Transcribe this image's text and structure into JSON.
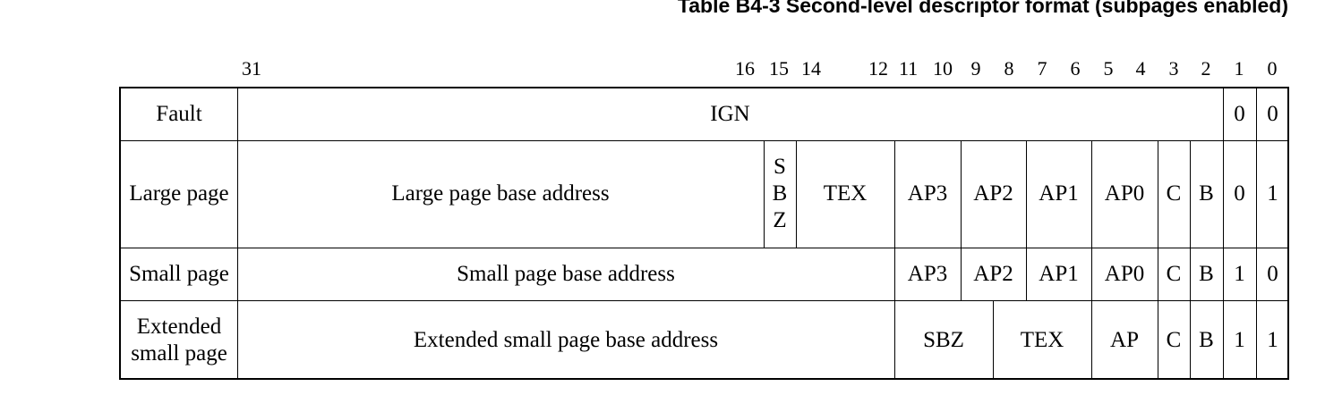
{
  "title": "Table B4-3 Second-level descriptor format (subpages enabled)",
  "bit_labels": [
    "31",
    "16",
    "15",
    "14",
    "12",
    "11",
    "10",
    "9",
    "8",
    "7",
    "6",
    "5",
    "4",
    "3",
    "2",
    "1",
    "0"
  ],
  "rows": [
    {
      "name": "Fault",
      "fields": [
        "IGN"
      ],
      "bits": [
        "0",
        "0"
      ]
    },
    {
      "name": "Large page",
      "fields": [
        "Large page base address",
        "S",
        "B",
        "Z",
        "TEX",
        "AP3",
        "AP2",
        "AP1",
        "AP0",
        "C",
        "B"
      ],
      "bits": [
        "0",
        "1"
      ]
    },
    {
      "name": "Small page",
      "fields": [
        "Small page base address",
        "AP3",
        "AP2",
        "AP1",
        "AP0",
        "C",
        "B"
      ],
      "bits": [
        "1",
        "0"
      ]
    },
    {
      "name_lines": [
        "Extended",
        "small page"
      ],
      "fields": [
        "Extended small page base address",
        "SBZ",
        "TEX",
        "AP",
        "C",
        "B"
      ],
      "bits": [
        "1",
        "1"
      ]
    }
  ]
}
